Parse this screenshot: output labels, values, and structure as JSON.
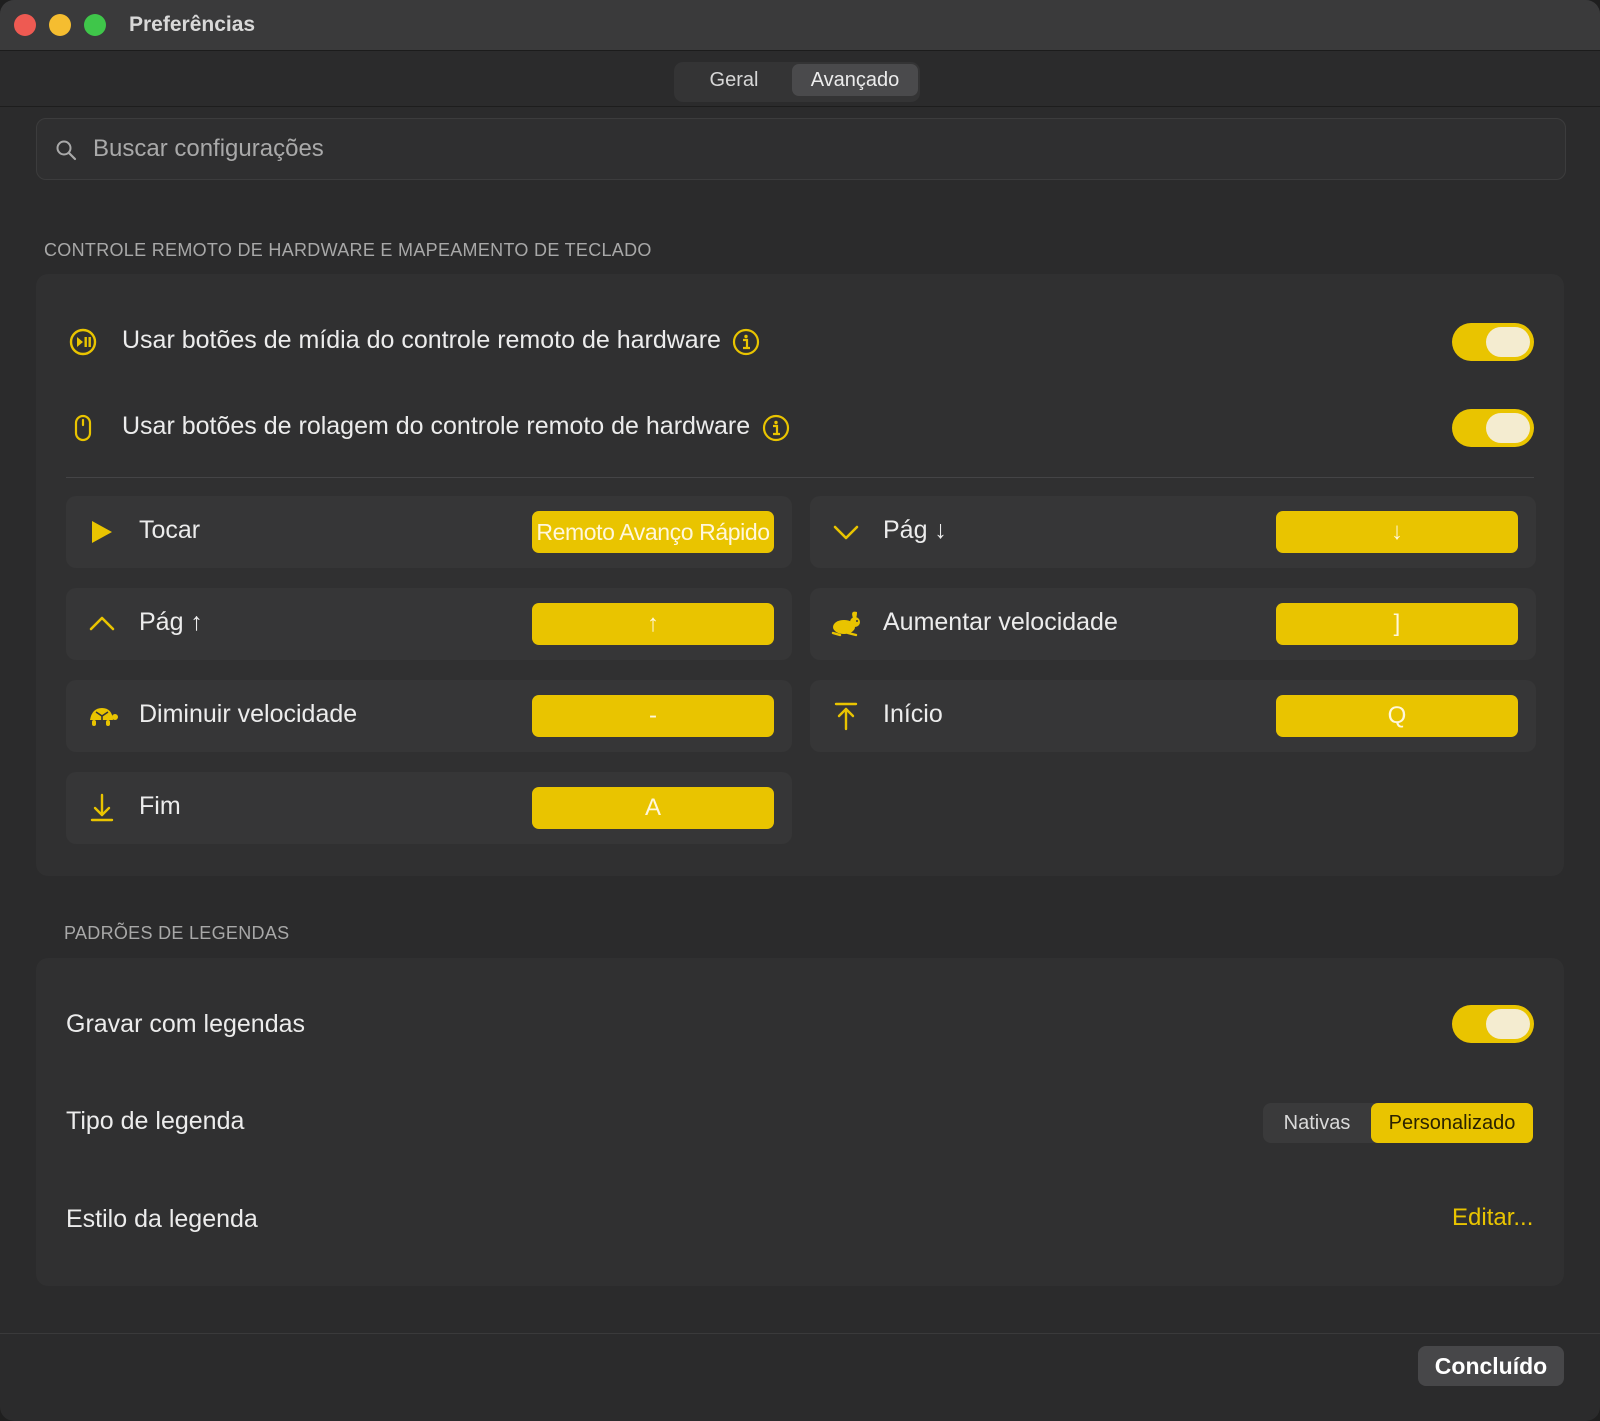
{
  "window": {
    "title": "Preferências"
  },
  "tabs": [
    {
      "label": "Geral",
      "selected": false
    },
    {
      "label": "Avançado",
      "selected": true
    }
  ],
  "search": {
    "placeholder": "Buscar configurações",
    "value": ""
  },
  "hardware_section": {
    "title": "CONTROLE REMOTO DE HARDWARE E MAPEAMENTO DE TECLADO",
    "options": [
      {
        "label": "Usar botões de mídia do controle remoto de hardware",
        "icon": "media-remote-icon",
        "enabled": true
      },
      {
        "label": "Usar botões de rolagem do controle remoto de hardware",
        "icon": "mouse-icon",
        "enabled": true
      }
    ],
    "mappings": [
      {
        "label": "Tocar",
        "icon": "play-icon",
        "key": "Remoto Avanço Rápido"
      },
      {
        "label": "Pág ↓",
        "icon": "chevron-down-icon",
        "key": "↓"
      },
      {
        "label": "Pág ↑",
        "icon": "chevron-up-icon",
        "key": "↑"
      },
      {
        "label": "Aumentar velocidade",
        "icon": "rabbit-icon",
        "key": "]"
      },
      {
        "label": "Diminuir velocidade",
        "icon": "turtle-icon",
        "key": "-"
      },
      {
        "label": "Início",
        "icon": "arrow-to-top-icon",
        "key": "Q"
      },
      {
        "label": "Fim",
        "icon": "arrow-to-bottom-icon",
        "key": "A"
      }
    ]
  },
  "captions_section": {
    "title": "PADRÕES DE LEGENDAS",
    "record_label": "Gravar com legendas",
    "record_enabled": true,
    "type_label": "Tipo de legenda",
    "type_options": [
      "Nativas",
      "Personalizado"
    ],
    "type_selected": "Personalizado",
    "style_label": "Estilo da legenda",
    "style_action": "Editar..."
  },
  "footer": {
    "done_label": "Concluído"
  },
  "colors": {
    "accent": "#e9c400",
    "background": "#2b2b2c",
    "panel": "#303031",
    "card": "#363637"
  }
}
